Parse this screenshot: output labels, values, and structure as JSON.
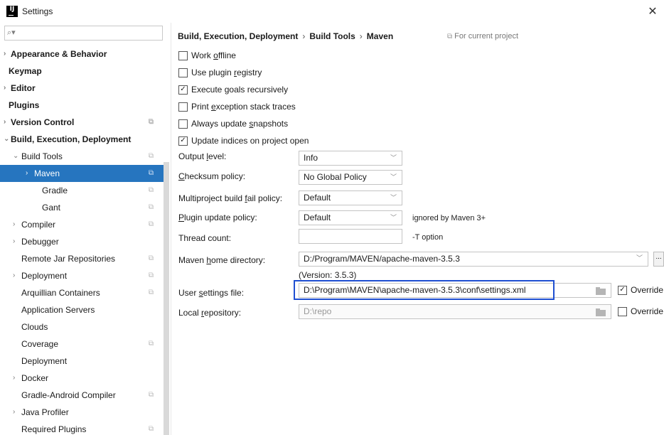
{
  "window": {
    "title": "Settings",
    "app_icon_text": "IJ"
  },
  "search": {
    "icon": "search-icon",
    "placeholder": ""
  },
  "sidebar": {
    "items": [
      {
        "label": "Appearance & Behavior",
        "level": 0,
        "bold": true,
        "arrow": "›",
        "proj": ""
      },
      {
        "label": "Keymap",
        "level": 0,
        "bold": true,
        "arrow": "",
        "proj": ""
      },
      {
        "label": "Editor",
        "level": 0,
        "bold": true,
        "arrow": "›",
        "proj": ""
      },
      {
        "label": "Plugins",
        "level": 0,
        "bold": true,
        "arrow": "",
        "proj": ""
      },
      {
        "label": "Version Control",
        "level": 0,
        "bold": true,
        "arrow": "›",
        "proj": "⧉"
      },
      {
        "label": "Build, Execution, Deployment",
        "level": 0,
        "bold": true,
        "arrow": "⌄",
        "proj": ""
      },
      {
        "label": "Build Tools",
        "level": 1,
        "bold": false,
        "arrow": "⌄",
        "proj": "⧉"
      },
      {
        "label": "Maven",
        "level": 2,
        "bold": false,
        "arrow": "›",
        "proj": "⧉",
        "selected": true
      },
      {
        "label": "Gradle",
        "level": 2,
        "bold": false,
        "arrow": "",
        "proj": "⧉"
      },
      {
        "label": "Gant",
        "level": 2,
        "bold": false,
        "arrow": "",
        "proj": "⧉"
      },
      {
        "label": "Compiler",
        "level": 1,
        "bold": false,
        "arrow": "›",
        "proj": "⧉"
      },
      {
        "label": "Debugger",
        "level": 1,
        "bold": false,
        "arrow": "›",
        "proj": ""
      },
      {
        "label": "Remote Jar Repositories",
        "level": 1,
        "bold": false,
        "arrow": "",
        "proj": "⧉"
      },
      {
        "label": "Deployment",
        "level": 1,
        "bold": false,
        "arrow": "›",
        "proj": "⧉"
      },
      {
        "label": "Arquillian Containers",
        "level": 1,
        "bold": false,
        "arrow": "",
        "proj": "⧉"
      },
      {
        "label": "Application Servers",
        "level": 1,
        "bold": false,
        "arrow": "",
        "proj": ""
      },
      {
        "label": "Clouds",
        "level": 1,
        "bold": false,
        "arrow": "",
        "proj": ""
      },
      {
        "label": "Coverage",
        "level": 1,
        "bold": false,
        "arrow": "",
        "proj": "⧉"
      },
      {
        "label": "Deployment",
        "level": 1,
        "bold": false,
        "arrow": "",
        "proj": ""
      },
      {
        "label": "Docker",
        "level": 1,
        "bold": false,
        "arrow": "›",
        "proj": ""
      },
      {
        "label": "Gradle-Android Compiler",
        "level": 1,
        "bold": false,
        "arrow": "",
        "proj": "⧉"
      },
      {
        "label": "Java Profiler",
        "level": 1,
        "bold": false,
        "arrow": "›",
        "proj": ""
      },
      {
        "label": "Required Plugins",
        "level": 1,
        "bold": false,
        "arrow": "",
        "proj": "⧉"
      }
    ]
  },
  "breadcrumb": {
    "parts": [
      "Build, Execution, Deployment",
      "Build Tools",
      "Maven"
    ],
    "separator": "›",
    "for_project": "For current project",
    "for_project_icon": "⧉"
  },
  "checkboxes": [
    {
      "pre": "Work ",
      "u": "o",
      "post": "ffline",
      "checked": false
    },
    {
      "pre": "Use plugin ",
      "u": "r",
      "post": "egistry",
      "checked": false
    },
    {
      "pre": "Execute ",
      "u": "g",
      "post": "oals recursively",
      "checked": true
    },
    {
      "pre": "Print ",
      "u": "e",
      "post": "xception stack traces",
      "checked": false
    },
    {
      "pre": "Always update ",
      "u": "s",
      "post": "napshots",
      "checked": false
    },
    {
      "pre": "Update indices on project open",
      "u": "",
      "post": "",
      "checked": true
    }
  ],
  "fields": {
    "output_level": {
      "pre": "Output ",
      "u": "l",
      "post": "evel:",
      "value": "Info"
    },
    "checksum_policy": {
      "pre": "",
      "u": "C",
      "post": "hecksum policy:",
      "value": "No Global Policy"
    },
    "multiproject": {
      "pre": "Multiproject build ",
      "u": "f",
      "post": "ail policy:",
      "value": "Default"
    },
    "plugin_update": {
      "pre": "",
      "u": "P",
      "post": "lugin update policy:",
      "value": "Default",
      "hint": "ignored by Maven 3+"
    },
    "thread_count": {
      "label": "Thread count:",
      "value": "",
      "hint": "-T option"
    },
    "maven_home": {
      "pre": "Maven ",
      "u": "h",
      "post": "ome directory:",
      "value": "D:/Program/MAVEN/apache-maven-3.5.3",
      "version": "(Version: 3.5.3)",
      "browse": "..."
    },
    "user_settings": {
      "pre": "User ",
      "u": "s",
      "post": "ettings file:",
      "value": "D:\\Program\\MAVEN\\apache-maven-3.5.3\\conf\\settings.xml",
      "override": "Override",
      "override_checked": true
    },
    "local_repo": {
      "pre": "Local ",
      "u": "r",
      "post": "epository:",
      "value": "D:\\repo",
      "override": "Override",
      "override_checked": false
    }
  },
  "colors": {
    "selection": "#2675bf",
    "highlight_box": "#1f4fd1"
  }
}
